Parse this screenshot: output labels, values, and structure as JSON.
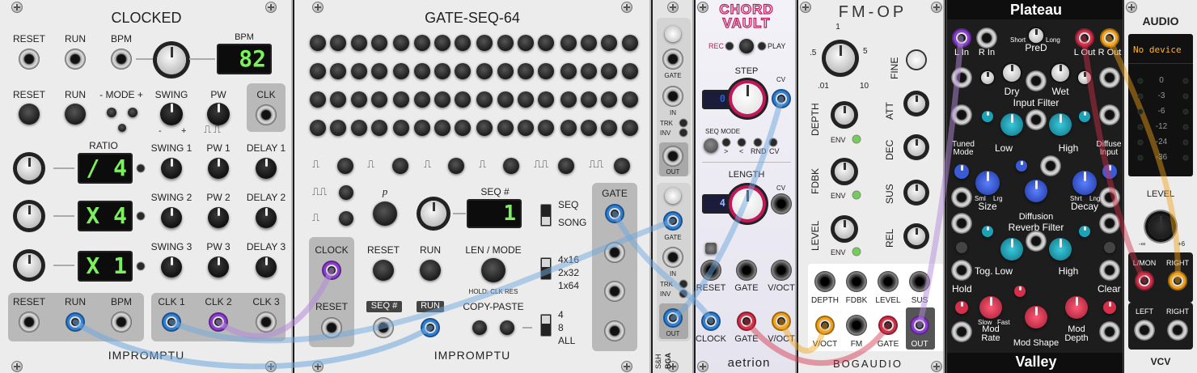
{
  "clocked": {
    "title": "CLOCKED",
    "brand": "IMPROMPTU",
    "row1": [
      "RESET",
      "RUN",
      "BPM"
    ],
    "bpm_label": "BPM",
    "bpm_display": "82",
    "row2": [
      "RESET",
      "RUN"
    ],
    "mode_label": "- MODE +",
    "swing_label": "SWING",
    "swing_marks": [
      "-",
      "+"
    ],
    "pw_label": "PW",
    "clk_label": "CLK",
    "ratio_label": "RATIO",
    "ratio_displays": [
      "/ 4",
      "X 4",
      "X 1"
    ],
    "sub_labels": [
      [
        "SWING 1",
        "PW 1",
        "DELAY 1"
      ],
      [
        "SWING 2",
        "PW 2",
        "DELAY 2"
      ],
      [
        "SWING 3",
        "PW 3",
        "DELAY 3"
      ]
    ],
    "out_labels": [
      "RESET",
      "RUN",
      "BPM",
      "CLK 1",
      "CLK 2",
      "CLK 3"
    ]
  },
  "gateseq": {
    "title": "GATE-SEQ-64",
    "brand": "IMPROMPTU",
    "p_label": "p",
    "seq_label": "SEQ #",
    "seq_display": "1",
    "seq_song": [
      "SEQ",
      "SONG"
    ],
    "clock_label": "CLOCK",
    "reset_label": "RESET",
    "reset2": "RESET",
    "run2": "RUN",
    "len_mode": "LEN / MODE",
    "hold_clk": "HOLD: CLK RES",
    "copy_paste": "COPY-PASTE",
    "layout_opts": [
      "4x16",
      "2x32",
      "1x64"
    ],
    "count_opts": [
      "4",
      "8",
      "ALL"
    ],
    "gate_label": "GATE",
    "seq_tag": "SEQ #",
    "run_tag": "RUN"
  },
  "sh": {
    "labels": [
      "GATE",
      "IN",
      "TRK",
      "INV",
      "OUT",
      "GATE",
      "IN",
      "TRK",
      "INV",
      "OUT"
    ],
    "vertical": "S&H",
    "brand": "BGA"
  },
  "chord": {
    "title1": "CHORD",
    "title2": "VAULT",
    "rec": "REC",
    "play": "PLAY",
    "step": "STEP",
    "cv": "CV",
    "step_display": "0",
    "seq_mode": "SEQ MODE",
    "mode_opts": [
      ">",
      "<",
      "RND",
      "CV"
    ],
    "length": "LENGTH",
    "length_display": "4",
    "cv2": "CV",
    "row_labels": [
      "RESET",
      "GATE",
      "V/OCT"
    ],
    "out_labels": [
      "CLOCK",
      "GATE",
      "V/OCT"
    ],
    "brand": "aetrion"
  },
  "fmop": {
    "title": "FM-OP",
    "ratio_marks": [
      "1",
      ".5",
      "5",
      ".01",
      "10"
    ],
    "fine": "FINE",
    "depth": "DEPTH",
    "fdbk": "FDBK",
    "level": "LEVEL",
    "env": "ENV",
    "adsr": [
      "ATT",
      "DEC",
      "SUS",
      "REL"
    ],
    "scale_marks": [
      "0",
      "10",
      "5"
    ],
    "jack_labels": [
      "DEPTH",
      "FDBK",
      "LEVEL",
      "SUS",
      "V/OCT",
      "FM",
      "GATE",
      "OUT"
    ],
    "brand": "BOGAUDIO"
  },
  "plateau": {
    "title": "Plateau",
    "brand": "Valley",
    "top_labels": [
      "L In",
      "R In",
      "PreD",
      "L Out",
      "R Out"
    ],
    "pred_marks": [
      "Short",
      "Long"
    ],
    "dry": "Dry",
    "wet": "Wet",
    "input_filter": "Input Filter",
    "tuned_mode": "Tuned Mode",
    "low": "Low",
    "high": "High",
    "diffuse_input": "Diffuse Input",
    "size": "Size",
    "decay": "Decay",
    "size_marks": [
      "Sml",
      "Lrg"
    ],
    "decay_marks": [
      "Shrt",
      "Lng"
    ],
    "diffusion": "Diffusion",
    "reverb_filter": "Reverb Filter",
    "tog": "Tog.",
    "low2": "Low",
    "high2": "High",
    "hold": "Hold",
    "clear": "Clear",
    "mod_rate": "Mod Rate",
    "mod_shape": "Mod Shape",
    "mod_depth": "Mod Depth",
    "slow_fast": [
      "Slow",
      "Fast"
    ]
  },
  "audio": {
    "title": "AUDIO",
    "device": "No device",
    "meter": [
      "0",
      "-3",
      "-6",
      "-12",
      "-24",
      "-36"
    ],
    "level": "LEVEL",
    "level_marks": [
      "-∞",
      "+6"
    ],
    "lmon": "L/MON",
    "right": "RIGHT",
    "left": "LEFT",
    "right2": "RIGHT",
    "brand": "VCV"
  },
  "colors": {
    "cable_blue": "#6fa8dc",
    "cable_purple": "#b48ad8",
    "plug_blue": "#2f7fd6",
    "plug_purple": "#8b3fd0",
    "plug_red": "#d5304a",
    "plug_orange": "#f2a31b",
    "plateau_teal": "#1aa3b8"
  }
}
